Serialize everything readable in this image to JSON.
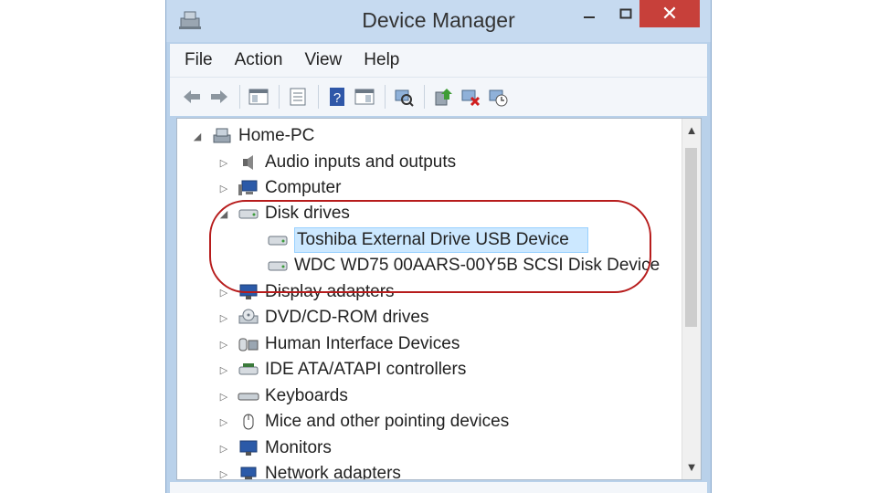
{
  "window": {
    "title": "Device Manager"
  },
  "menu": [
    "File",
    "Action",
    "View",
    "Help"
  ],
  "toolbar_icons": [
    "back-arrow-icon",
    "forward-arrow-icon",
    "show-hide-tree-icon",
    "properties-icon",
    "help-icon",
    "action-pane-icon",
    "scan-hardware-icon",
    "update-driver-icon",
    "uninstall-device-icon",
    "enable-device-icon"
  ],
  "tree": {
    "root": "Home-PC",
    "items": [
      {
        "label": "Audio inputs and outputs"
      },
      {
        "label": "Computer"
      },
      {
        "label": "Disk drives",
        "children": [
          "Toshiba External Drive USB Device",
          "WDC WD75 00AARS-00Y5B SCSI Disk Device"
        ]
      },
      {
        "label": "Display adapters"
      },
      {
        "label": "DVD/CD-ROM drives"
      },
      {
        "label": "Human Interface Devices"
      },
      {
        "label": "IDE ATA/ATAPI controllers"
      },
      {
        "label": "Keyboards"
      },
      {
        "label": "Mice and other pointing devices"
      },
      {
        "label": "Monitors"
      },
      {
        "label": "Network adapters"
      }
    ]
  },
  "colors": {
    "accent_close": "#c7403a",
    "highlight_ring": "#b71c1c",
    "selection": "#cce8ff"
  }
}
